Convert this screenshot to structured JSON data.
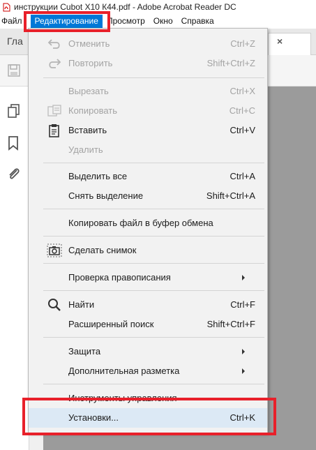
{
  "window": {
    "title": "инструкции Cubot X10 К44.pdf - Adobe Acrobat Reader DC"
  },
  "menubar": {
    "items": [
      "Файл",
      "Редактирование",
      "Просмотр",
      "Окно",
      "Справка"
    ],
    "active": "Редактирование"
  },
  "app": {
    "home_tab": "Гла"
  },
  "edit_menu": {
    "undo": {
      "label": "Отменить",
      "shortcut": "Ctrl+Z"
    },
    "redo": {
      "label": "Повторить",
      "shortcut": "Shift+Ctrl+Z"
    },
    "cut": {
      "label": "Вырезать",
      "shortcut": "Ctrl+X"
    },
    "copy": {
      "label": "Копировать",
      "shortcut": "Ctrl+C"
    },
    "paste": {
      "label": "Вставить",
      "shortcut": "Ctrl+V"
    },
    "delete": {
      "label": "Удалить"
    },
    "select_all": {
      "label": "Выделить все",
      "shortcut": "Ctrl+A"
    },
    "deselect": {
      "label": "Снять выделение",
      "shortcut": "Shift+Ctrl+A"
    },
    "copy_file": {
      "label": "Копировать файл в буфер обмена"
    },
    "snapshot": {
      "label": "Сделать снимок"
    },
    "spellcheck": {
      "label": "Проверка правописания"
    },
    "find": {
      "label": "Найти",
      "shortcut": "Ctrl+F"
    },
    "advanced_search": {
      "label": "Расширенный поиск",
      "shortcut": "Shift+Ctrl+F"
    },
    "protection": {
      "label": "Защита"
    },
    "extra_markup": {
      "label": "Дополнительная разметка"
    },
    "manage_tools": {
      "label": "Инструменты управления"
    },
    "preferences": {
      "label": "Установки...",
      "shortcut": "Ctrl+K"
    }
  },
  "colors": {
    "menu_active_bg": "#0078d7",
    "highlight_outline": "#e8202a",
    "hover_row": "#dce9f5",
    "disabled_text": "#a3a3a3"
  }
}
